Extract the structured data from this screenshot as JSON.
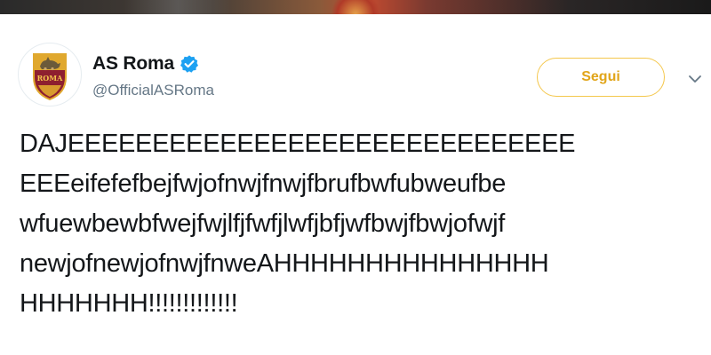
{
  "account": {
    "display_name": "AS Roma",
    "handle": "@OfficialASRoma",
    "verified": true,
    "avatar_text": "ROMA"
  },
  "follow_button": {
    "label": "Segui"
  },
  "tweet": {
    "lines": [
      "DAJEEEEEEEEEEEEEEEEEEEEEEEEEEEEEE",
      "EEEeifefefbejfwjofnwjfnwjfbrufbwfubweufbe",
      "wfuewbewbfwejfwjlfjfwfjlwfjbfjwfbwjfbwjofwjf",
      "newjofnewjofnwjfnweAHHHHHHHHHHHHHHH",
      "HHHHHHH!!!!!!!!!!!!!"
    ]
  },
  "icons": {
    "verified": "verified-badge-icon",
    "caret": "chevron-down-icon"
  },
  "colors": {
    "accent": "#f4c74c",
    "follow_text": "#e1a51a",
    "verified_blue": "#1da1f2",
    "text_primary": "#14171a",
    "text_secondary": "#657786"
  }
}
